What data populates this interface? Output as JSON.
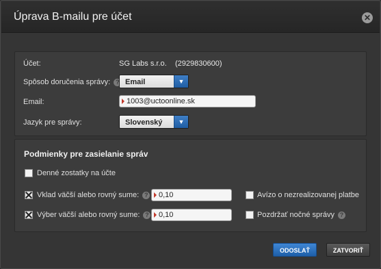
{
  "dialog": {
    "title": "Úprava B-mailu pre účet"
  },
  "account": {
    "label": "Účet:",
    "name": "SG Labs s.r.o.",
    "number": "(2929830600)"
  },
  "delivery": {
    "label": "Spôsob doručenia správy:",
    "value": "Email"
  },
  "email": {
    "label": "Email:",
    "value": "1003@uctoonline.sk"
  },
  "language": {
    "label": "Jazyk pre správy:",
    "value": "Slovenský"
  },
  "conditions": {
    "title": "Podmienky pre zasielanie správ",
    "daily_balance": {
      "label": "Denné zostatky na účte",
      "checked": false
    },
    "deposit": {
      "label": "Vklad väčší alebo rovný sume:",
      "checked": true,
      "amount": "0,10"
    },
    "withdrawal": {
      "label": "Výber väčší alebo rovný sume:",
      "checked": true,
      "amount": "0,10"
    },
    "unrealized_payment": {
      "label": "Avízo o nezrealizovanej platbe",
      "checked": false
    },
    "hold_night": {
      "label": "Pozdržať nočné správy",
      "checked": false
    }
  },
  "buttons": {
    "send": "ODOSLAŤ",
    "close": "ZATVORIŤ"
  },
  "icons": {
    "close": "close-icon",
    "help": "help-icon",
    "dropdown": "chevron-down-icon"
  }
}
